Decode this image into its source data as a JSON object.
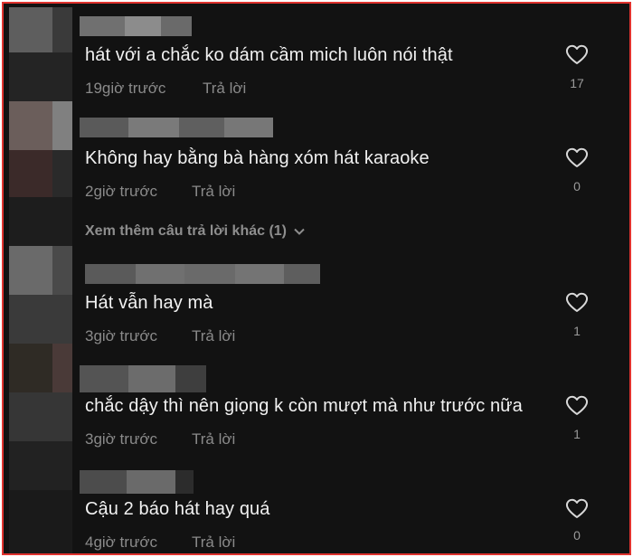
{
  "comments": [
    {
      "text": "hát với a chắc ko dám cầm mich luôn nói thật",
      "time": "19giờ trước",
      "reply": "Trả lời",
      "likes": "17"
    },
    {
      "text": "Không hay bằng bà hàng xóm hát karaoke",
      "time": "2giờ trước",
      "reply": "Trả lời",
      "likes": "0"
    },
    {
      "text": "Hát vẫn hay mà",
      "time": "3giờ trước",
      "reply": "Trả lời",
      "likes": "1"
    },
    {
      "text": "chắc dậy thì nên giọng k còn mượt mà như trước nữa",
      "time": "3giờ trước",
      "reply": "Trả lời",
      "likes": "1"
    },
    {
      "text": "Cậu 2 báo hát hay quá",
      "time": "4giờ trước",
      "reply": "Trả lời",
      "likes": "0"
    }
  ],
  "view_more": {
    "label": "Xem thêm câu trả lời khác (1)"
  },
  "colors": {
    "background": "#121212",
    "border": "#e0332f",
    "text": "#f1f1f1",
    "muted": "#8a8a8a"
  },
  "icons": {
    "like": "heart-outline-icon",
    "expand": "chevron-down-icon"
  }
}
